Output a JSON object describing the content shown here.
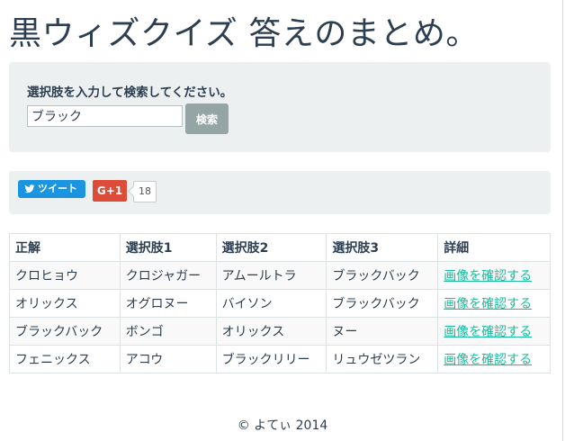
{
  "page_title": "黒ウィズクイズ 答えのまとめ。",
  "search": {
    "prompt": "選択肢を入力して検索してください。",
    "input_value": "ブラック",
    "placeholder": "",
    "button_label": "検索"
  },
  "social": {
    "tweet_label": "ツイート",
    "gplus_label": "G+1",
    "gplus_count": "18",
    "colors": {
      "twitter": "#1b95e0",
      "gplus": "#dd4b39"
    }
  },
  "table": {
    "headers": [
      "正解",
      "選択肢1",
      "選択肢2",
      "選択肢3",
      "詳細"
    ],
    "rows": [
      [
        "クロヒョウ",
        "クロジャガー",
        "アムールトラ",
        "ブラックバック",
        "画像を確認する"
      ],
      [
        "オリックス",
        "オグロヌー",
        "バイソン",
        "ブラックバック",
        "画像を確認する"
      ],
      [
        "ブラックバック",
        "ボンゴ",
        "オリックス",
        "ヌー",
        "画像を確認する"
      ],
      [
        "フェニックス",
        "アコウ",
        "ブラックリリー",
        "リュウゼツラン",
        "画像を確認する"
      ]
    ],
    "link_color": "#18bc9c"
  },
  "footer": "© よてぃ 2014",
  "colors": {
    "text": "#2c3e50",
    "well_bg": "#ecf0f1",
    "button_bg": "#95a5a6"
  }
}
